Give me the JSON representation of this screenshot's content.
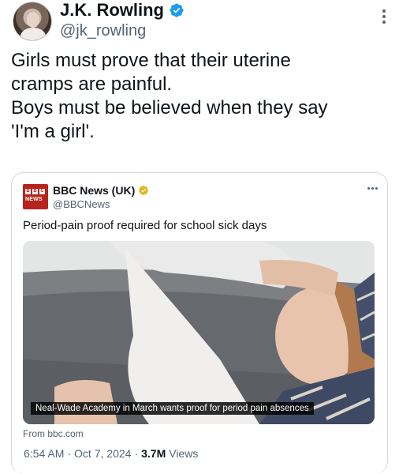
{
  "author": {
    "display_name": "J.K. Rowling",
    "handle": "@jk_rowling"
  },
  "tweet": {
    "lines": [
      "Girls must prove that their uterine",
      "cramps are painful.",
      "Boys must be believed when they say",
      "'I'm a girl'."
    ]
  },
  "quote": {
    "logo_text": "NEWS",
    "display_name": "BBC News (UK)",
    "handle": "@BBCNews",
    "text": "Period-pain proof required for school sick days",
    "media_caption": "Neal-Wade Academy in March wants proof for period pain absences",
    "source": "From bbc.com"
  },
  "meta": {
    "time": "6:54 AM",
    "separator": "·",
    "date": "Oct 7, 2024",
    "views_count": "3.7M",
    "views_label": "Views"
  },
  "colors": {
    "verified_blue": "#1d9bf0",
    "verified_gold": "#e2b719",
    "bbc_red": "#b8231b",
    "secondary_text": "#536471"
  },
  "icons": {
    "verified": "verified-badge-icon",
    "more": "more-options-icon"
  }
}
